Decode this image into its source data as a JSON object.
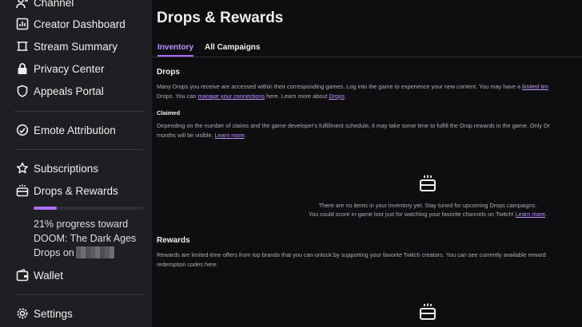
{
  "sidebar": {
    "items": {
      "channel": "Channel",
      "creator_dashboard": "Creator Dashboard",
      "stream_summary": "Stream Summary",
      "privacy_center": "Privacy Center",
      "appeals_portal": "Appeals Portal",
      "emote_attribution": "Emote Attribution",
      "subscriptions": "Subscriptions",
      "drops_rewards": "Drops & Rewards",
      "wallet": "Wallet",
      "settings": "Settings"
    },
    "drops_progress": {
      "percent": 21,
      "line1": "21% progress toward",
      "line2": "DOOM: The Dark Ages",
      "line3": "Drops on"
    }
  },
  "main": {
    "title": "Drops & Rewards",
    "tabs": [
      "Inventory",
      "All Campaigns"
    ],
    "active_tab": "Inventory",
    "drops": {
      "heading": "Drops",
      "line1_text": "Many Drops you receive are accessed within their corresponding games. Log into the game to experience your new content. You may have a ",
      "line1_link": "limited tim",
      "line2_prefix": "Drops. You can ",
      "line2_link1": "manage your connections",
      "line2_mid": " here. Learn more about ",
      "line2_link2": "Drops",
      "line2_end": "."
    },
    "claimed": {
      "heading": "Claimed",
      "line1": "Depending on the number of claims and the game developer's fulfillment schedule, it may take some time to fulfill the Drop rewards in the game. Only Dr",
      "line2_prefix": "months will be visible. ",
      "line2_link": "Learn more",
      "line2_end": "."
    },
    "empty": {
      "line1": "There are no items in your inventory yet. Stay tuned for upcoming Drops campaigns.",
      "line2_prefix": "You could score in-game loot just for watching your favorite channels on Twitch! ",
      "line2_link": "Learn more",
      "line2_end": "."
    },
    "rewards": {
      "heading": "Rewards",
      "line1": "Rewards are limited-time offers from top brands that you can unlock by supporting your favorite Twitch creators. You can see currently available reward",
      "line2": "redemption codes here."
    }
  },
  "colors": {
    "accent": "#a970ff",
    "link": "#bf94ff",
    "sidebar_bg": "#1f1f23",
    "page_bg": "#0e0e10"
  }
}
